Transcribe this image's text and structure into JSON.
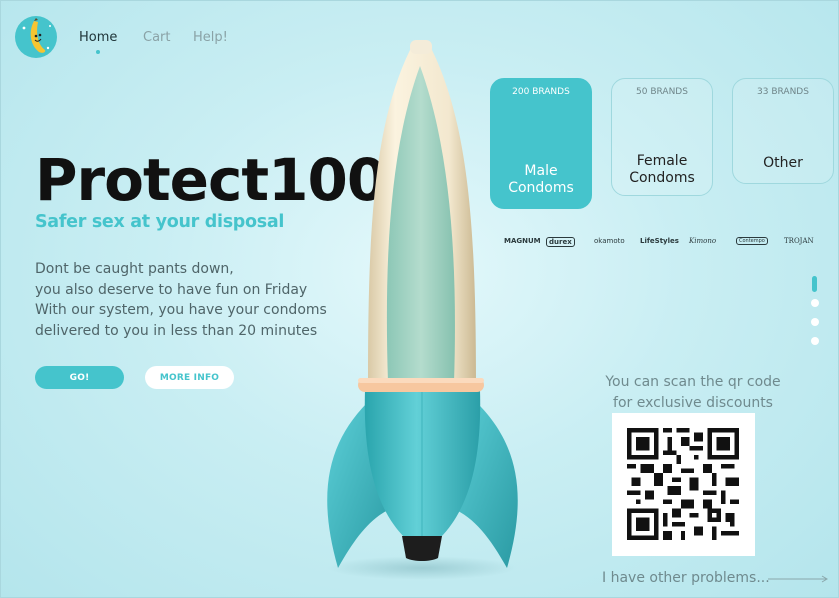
{
  "nav": {
    "home": "Home",
    "cart": "Cart",
    "help": "Help!"
  },
  "hero": {
    "title": "Protect100",
    "subtitle": "Safer sex at your disposal",
    "description": [
      "Dont be caught pants down,",
      "you also deserve to have fun on Friday",
      "With our system, you have your condoms",
      "delivered to you in less than 20 minutes"
    ],
    "go_label": "GO!",
    "more_label": "MORE INFO"
  },
  "categories": [
    {
      "count": "200 BRANDS",
      "label_line1": "Male",
      "label_line2": "Condoms",
      "active": true
    },
    {
      "count": "50 BRANDS",
      "label_line1": "Female",
      "label_line2": "Condoms",
      "active": false
    },
    {
      "count": "33 BRANDS",
      "label_line1": "Other",
      "label_line2": "",
      "active": false
    }
  ],
  "brands": [
    "MAGNUM",
    "durex",
    "okamoto",
    "LifeStyles",
    "Kimono",
    "Contempo",
    "TROJAN"
  ],
  "pager": {
    "total": 4,
    "active_index": 0
  },
  "qr": {
    "caption_line1": "You can scan the qr code",
    "caption_line2": "for exclusive discounts"
  },
  "footer": {
    "problems_link": "I have other problems..."
  },
  "colors": {
    "accent": "#45c4cc",
    "title": "#111111",
    "background": "#c9eef3"
  }
}
